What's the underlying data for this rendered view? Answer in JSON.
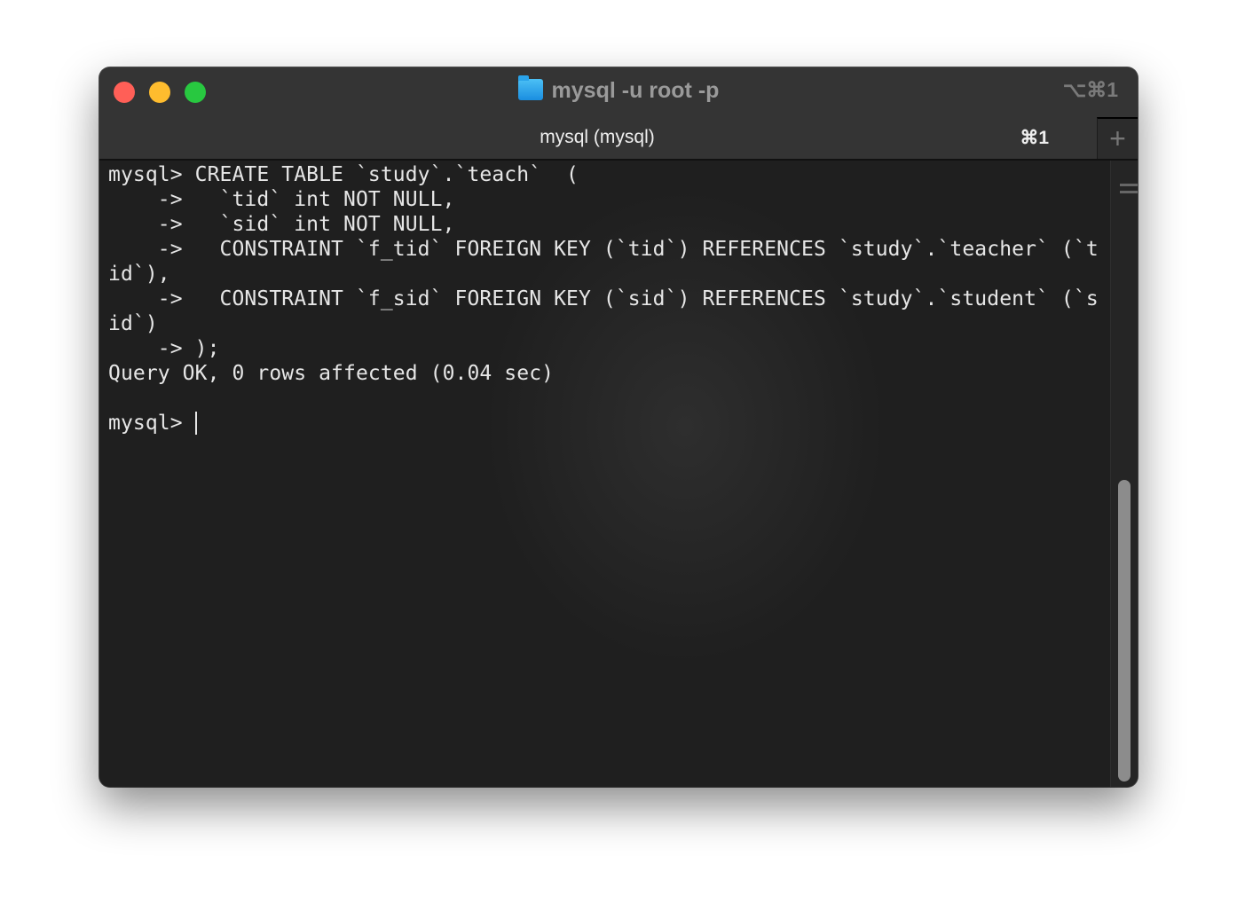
{
  "window": {
    "title": "mysql -u root -p",
    "title_icon": "folder-icon",
    "window_shortcut": "⌥⌘1",
    "traffic_lights": {
      "close": "#ff5f57",
      "minimize": "#febc2e",
      "zoom": "#28c840"
    }
  },
  "tabs": [
    {
      "label": "mysql (mysql)",
      "shortcut": "⌘1",
      "active": true
    }
  ],
  "new_tab_label": "+",
  "terminal": {
    "lines": [
      "mysql> CREATE TABLE `study`.`teach`  (",
      "    ->   `tid` int NOT NULL,",
      "    ->   `sid` int NOT NULL,",
      "    ->   CONSTRAINT `f_tid` FOREIGN KEY (`tid`) REFERENCES `study`.`teacher` (`t",
      "id`),",
      "    ->   CONSTRAINT `f_sid` FOREIGN KEY (`sid`) REFERENCES `study`.`student` (`s",
      "id`)",
      "    -> );",
      "Query OK, 0 rows affected (0.04 sec)",
      ""
    ],
    "prompt": "mysql> "
  }
}
